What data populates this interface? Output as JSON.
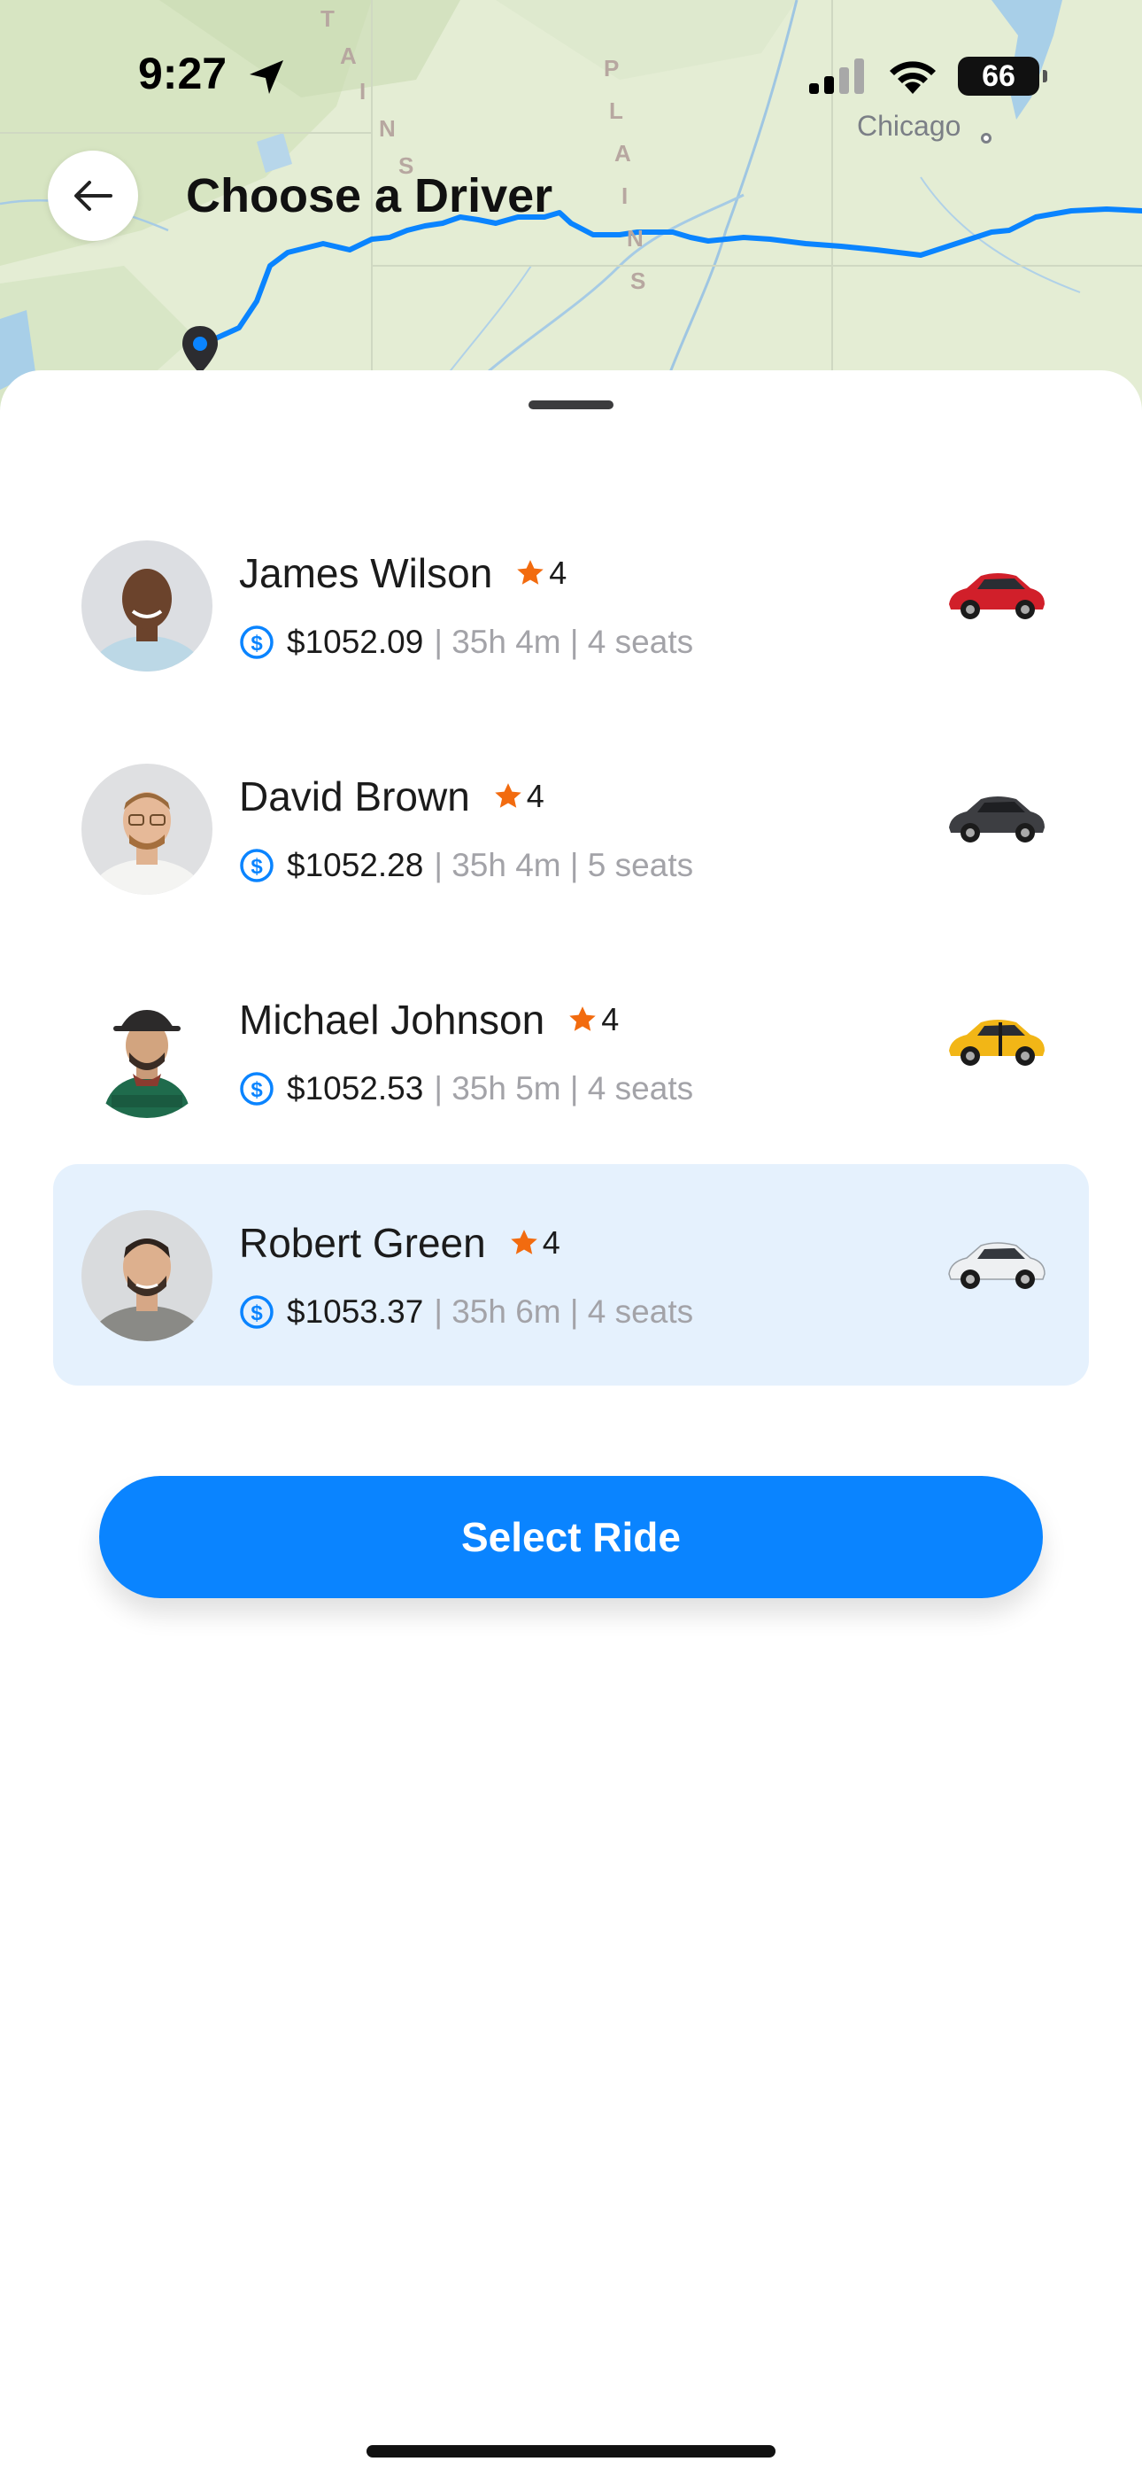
{
  "status_bar": {
    "time": "9:27",
    "battery": "66",
    "location_icon": "location-arrow-icon",
    "signal_icon": "cellular-signal-icon",
    "wifi_icon": "wifi-icon"
  },
  "map": {
    "city": "Chicago",
    "labels": [
      "T",
      "A",
      "I",
      "N",
      "S",
      "P",
      "L",
      "A",
      "I",
      "N",
      "S"
    ],
    "route_color": "#0a84ff",
    "pin_icon": "map-pin-icon"
  },
  "header": {
    "title": "Choose a Driver",
    "back_icon": "arrow-left-icon"
  },
  "drivers": [
    {
      "name": "James Wilson",
      "rating": "4",
      "price": "$1052.09",
      "meta": "| 35h 4m | 4 seats",
      "car_color": "#d11f2a",
      "selected": false
    },
    {
      "name": "David Brown",
      "rating": "4",
      "price": "$1052.28",
      "meta": "| 35h 4m | 5 seats",
      "car_color": "#3d3e42",
      "selected": false
    },
    {
      "name": "Michael Johnson",
      "rating": "4",
      "price": "$1052.53",
      "meta": "| 35h 5m | 4 seats",
      "car_color": "#f2b616",
      "selected": false
    },
    {
      "name": "Robert Green",
      "rating": "4",
      "price": "$1053.37",
      "meta": "| 35h 6m | 4 seats",
      "car_color": "#e9ecef",
      "selected": true
    }
  ],
  "actions": {
    "select_label": "Select Ride"
  },
  "colors": {
    "accent": "#0a84ff",
    "star": "#f26b0f",
    "selected_bg": "#e5f1fd",
    "meta_text": "#a3a3a8"
  }
}
